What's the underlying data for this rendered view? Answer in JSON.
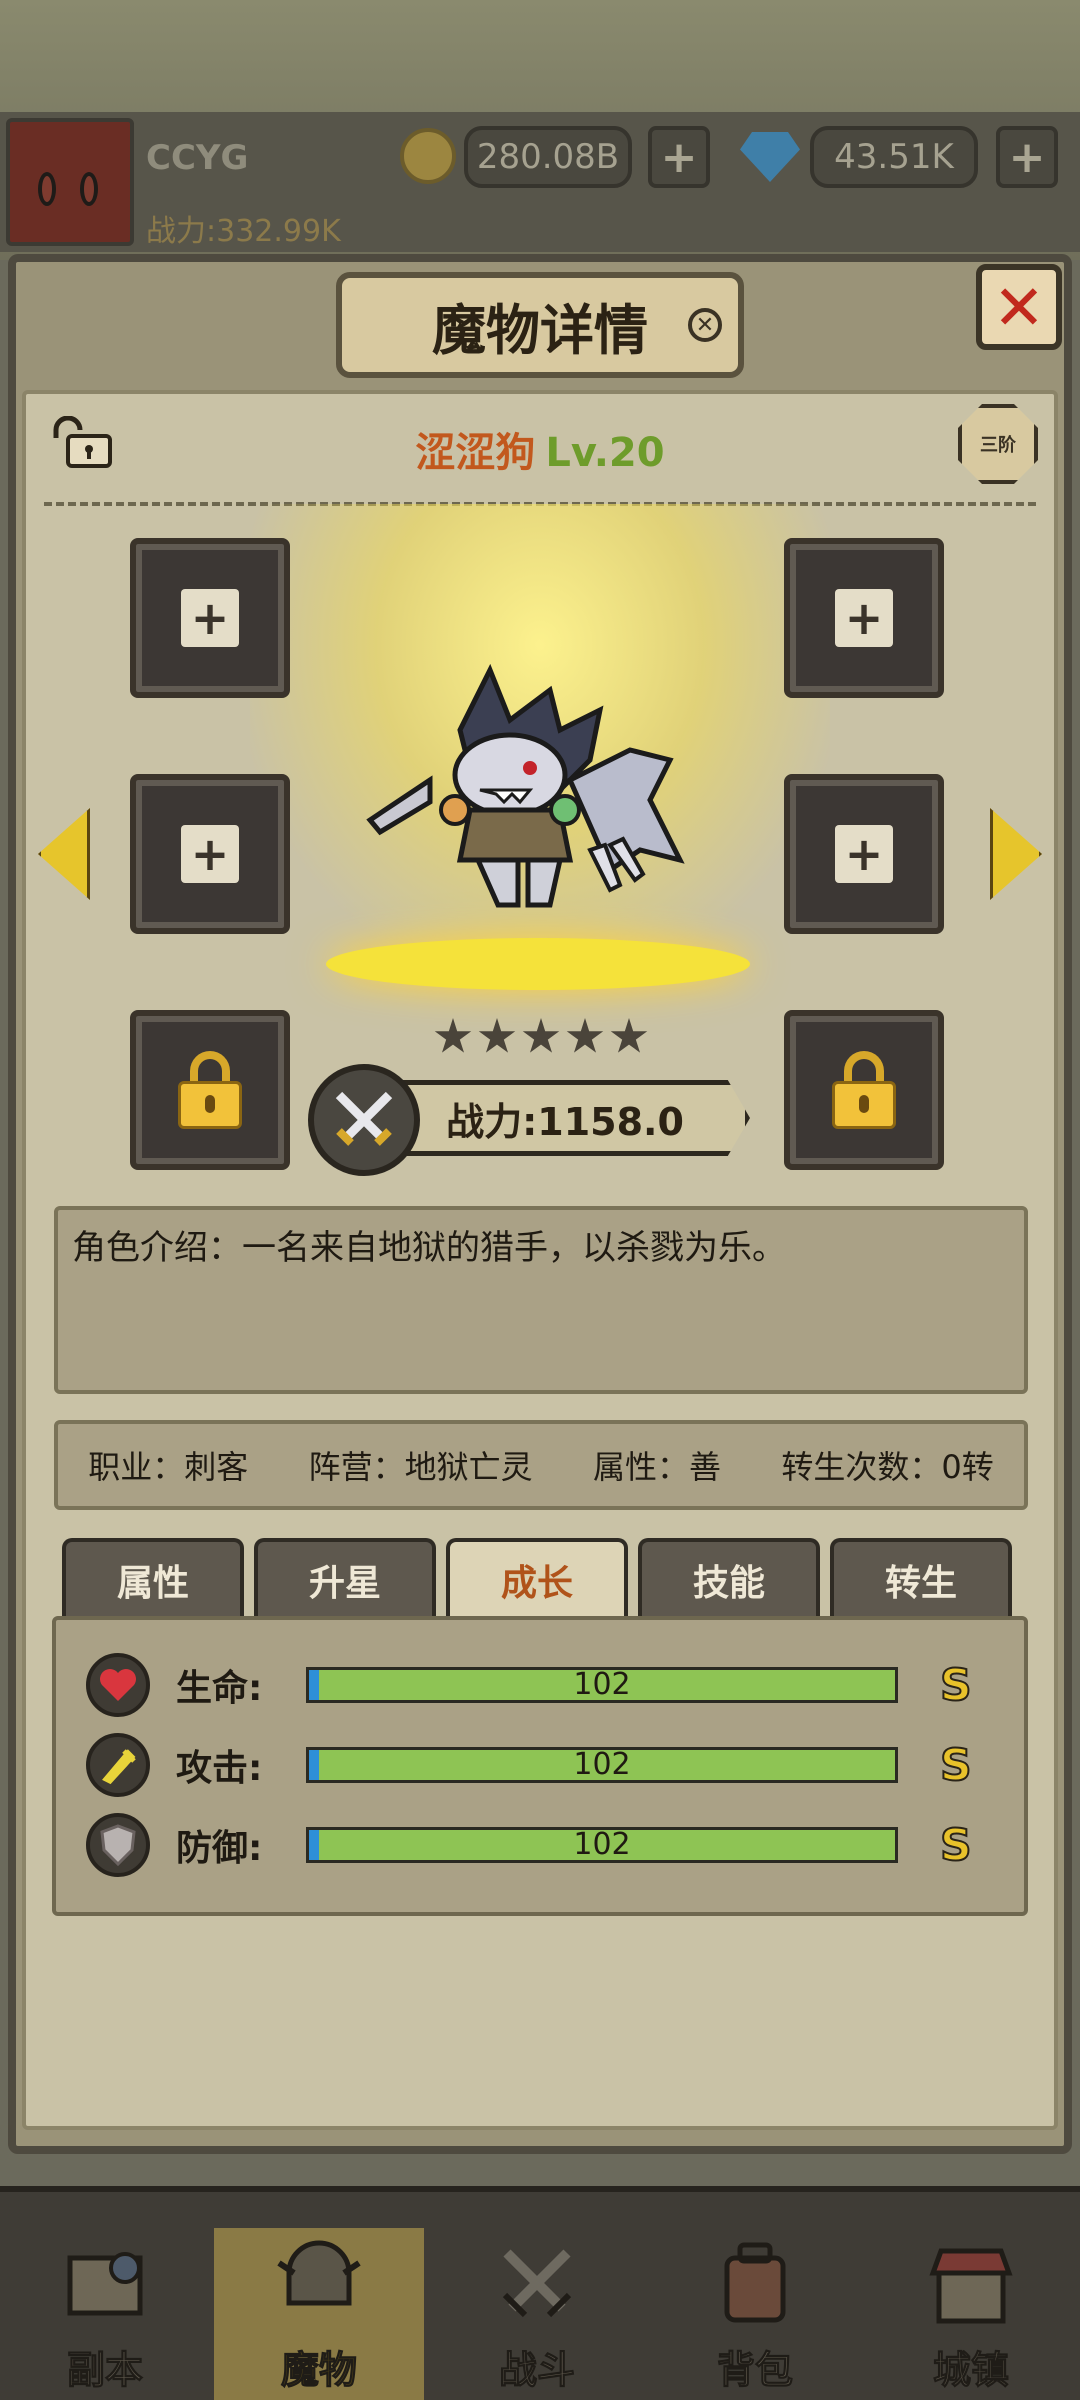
{
  "player": {
    "name": "CCYG",
    "power": "战力:332.99K",
    "gold": "280.08B",
    "gems": "43.51K"
  },
  "dialog": {
    "title": "魔物详情",
    "close_label": "✕"
  },
  "monster": {
    "name": "涩涩狗",
    "level": "Lv.20",
    "tier": "三阶",
    "stars": 5,
    "power": "战力:1158.0",
    "description": "角色介绍：一名来自地狱的猎手，以杀戮为乐。",
    "info": {
      "job": "职业：刺客",
      "faction": "阵营：地狱亡灵",
      "attribute": "属性：善",
      "rebirth": "转生次数：0转"
    }
  },
  "tabs": [
    {
      "label": "属性"
    },
    {
      "label": "升星"
    },
    {
      "label": "成长"
    },
    {
      "label": "技能"
    },
    {
      "label": "转生"
    }
  ],
  "active_tab": "成长",
  "stats": [
    {
      "label": "生命:",
      "value": "102",
      "grade": "S",
      "icon": "heart-icon"
    },
    {
      "label": "攻击:",
      "value": "102",
      "grade": "S",
      "icon": "attack-icon"
    },
    {
      "label": "防御:",
      "value": "102",
      "grade": "S",
      "icon": "shield-icon"
    }
  ],
  "nav": [
    {
      "label": "副本"
    },
    {
      "label": "魔物"
    },
    {
      "label": "战斗"
    },
    {
      "label": "背包"
    },
    {
      "label": "城镇"
    }
  ],
  "colors": {
    "accent_gold": "#e6c52c",
    "name_orange": "#c2581d",
    "level_green": "#6e9c2b",
    "bar_green": "#8ec454"
  }
}
